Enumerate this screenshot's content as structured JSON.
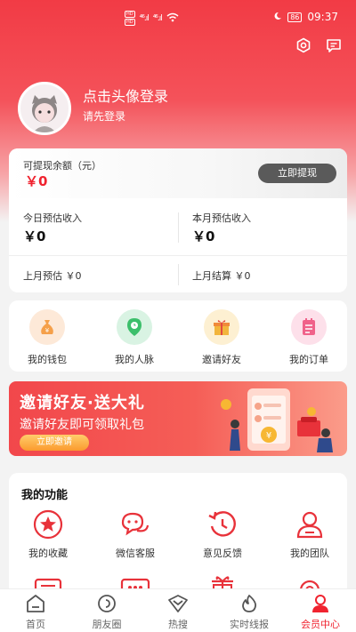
{
  "status_bar": {
    "network_left": "HD",
    "signal_a": "⁴⁶.ıl",
    "signal_b": "⁴⁶.ıl",
    "battery": "86",
    "time": "09:37"
  },
  "profile": {
    "login_prompt": "点击头像登录",
    "login_hint": "请先登录"
  },
  "balance": {
    "withdrawable_label": "可提现余额（元）",
    "withdrawable_value": "￥0",
    "withdraw_button": "立即提现",
    "today_est_label": "今日预估收入",
    "today_est_value": "￥0",
    "month_est_label": "本月预估收入",
    "month_est_value": "￥0",
    "last_month_est": "上月预估 ￥0",
    "last_month_settle": "上月结算 ￥0"
  },
  "shortcuts": [
    {
      "label": "我的钱包",
      "icon": "money-bag-icon",
      "color": "#f5a04a"
    },
    {
      "label": "我的人脉",
      "icon": "location-pin-icon",
      "color": "#3cbf6b"
    },
    {
      "label": "邀请好友",
      "icon": "gift-icon",
      "color": "#f2b53c"
    },
    {
      "label": "我的订单",
      "icon": "order-list-icon",
      "color": "#f0628a"
    }
  ],
  "banner": {
    "title": "邀请好友·送大礼",
    "subtitle": "邀请好友即可领取礼包",
    "button": "立即邀请"
  },
  "functions": {
    "title": "我的功能",
    "items": [
      {
        "label": "我的收藏",
        "icon": "star-icon"
      },
      {
        "label": "微信客服",
        "icon": "chat-icon"
      },
      {
        "label": "意见反馈",
        "icon": "feedback-icon"
      },
      {
        "label": "我的团队",
        "icon": "team-icon"
      }
    ]
  },
  "tabs": [
    {
      "label": "首页",
      "icon": "home-icon",
      "active": false
    },
    {
      "label": "朋友圈",
      "icon": "moments-icon",
      "active": false
    },
    {
      "label": "热搜",
      "icon": "hot-search-icon",
      "active": false
    },
    {
      "label": "实时线报",
      "icon": "live-news-icon",
      "active": false
    },
    {
      "label": "会员中心",
      "icon": "member-icon",
      "active": true
    }
  ],
  "colors": {
    "brand_red": "#f0232f",
    "header_red": "#f23b45"
  }
}
